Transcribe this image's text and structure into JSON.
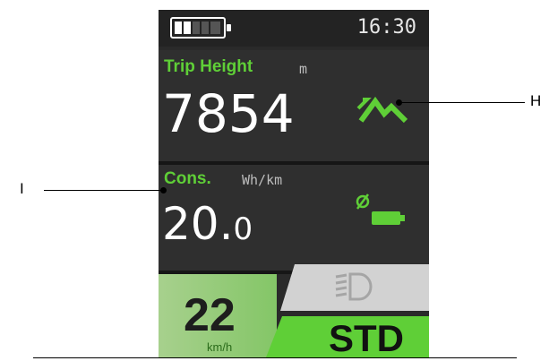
{
  "status": {
    "time": "16:30",
    "battery_level": 0.4,
    "battery_icon": "battery-icon"
  },
  "trip_height": {
    "label": "Trip Height",
    "unit": "m",
    "value": "7854",
    "icon": "mountain-icon"
  },
  "consumption": {
    "label": "Cons.",
    "unit": "Wh/km",
    "value_main": "20.",
    "value_decimal": "0",
    "icon": "battery-consumption-icon"
  },
  "speed": {
    "value": "22",
    "unit": "km/h"
  },
  "light": {
    "icon": "headlight-icon"
  },
  "assist_mode": {
    "label": "STD"
  },
  "callouts": {
    "h": "H",
    "i": "I"
  },
  "colors": {
    "accent_green": "#5fcf37",
    "speed_bg": "#9ccc7f",
    "screen_bg": "#2a2a2a"
  }
}
